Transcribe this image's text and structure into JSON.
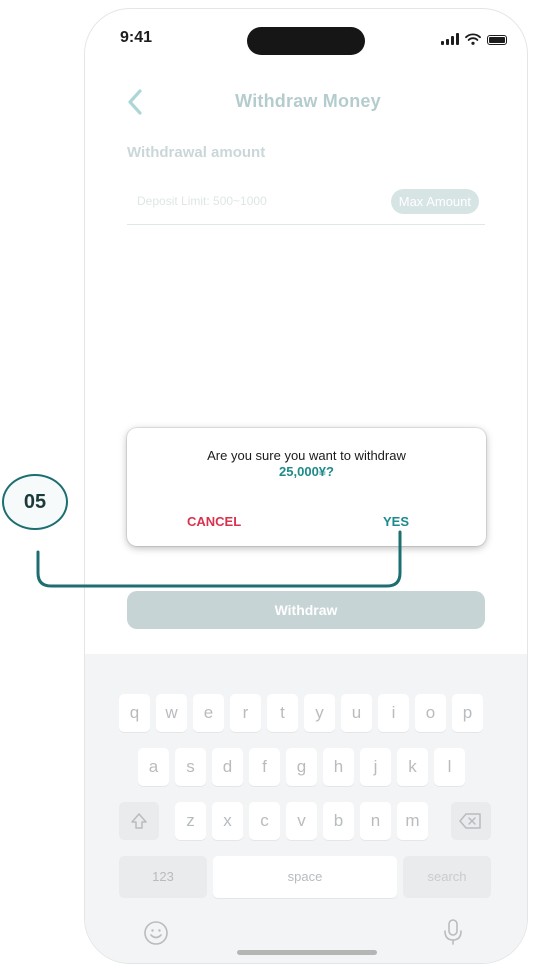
{
  "status_bar": {
    "time": "9:41"
  },
  "header": {
    "title": "Withdraw Money"
  },
  "form": {
    "amount_label": "Withdrawal amount",
    "placeholder": "Deposit Limit:  500~1000",
    "max_button": "Max Amount",
    "withdraw_button": "Withdraw"
  },
  "dialog": {
    "message": "Are you sure you want to withdraw",
    "amount": "25,000¥?",
    "cancel": "CANCEL",
    "yes": "YES"
  },
  "annotation": {
    "step": "05"
  },
  "keyboard": {
    "row1": [
      "q",
      "w",
      "e",
      "r",
      "t",
      "y",
      "u",
      "i",
      "o",
      "p"
    ],
    "row2": [
      "a",
      "s",
      "d",
      "f",
      "g",
      "h",
      "j",
      "k",
      "l"
    ],
    "row3": [
      "z",
      "x",
      "c",
      "v",
      "b",
      "n",
      "m"
    ],
    "numbers_key": "123",
    "space_key": "space",
    "search_key": "search"
  },
  "icons": [
    "chevron-left-icon",
    "signal-icon",
    "wifi-icon",
    "battery-icon",
    "shift-icon",
    "backspace-icon",
    "emoji-icon",
    "microphone-icon"
  ],
  "colors": {
    "accent": "#1c8a8d",
    "cancel": "#d9324f",
    "title": "#2a6d70",
    "annotation": "#1c6e70"
  }
}
